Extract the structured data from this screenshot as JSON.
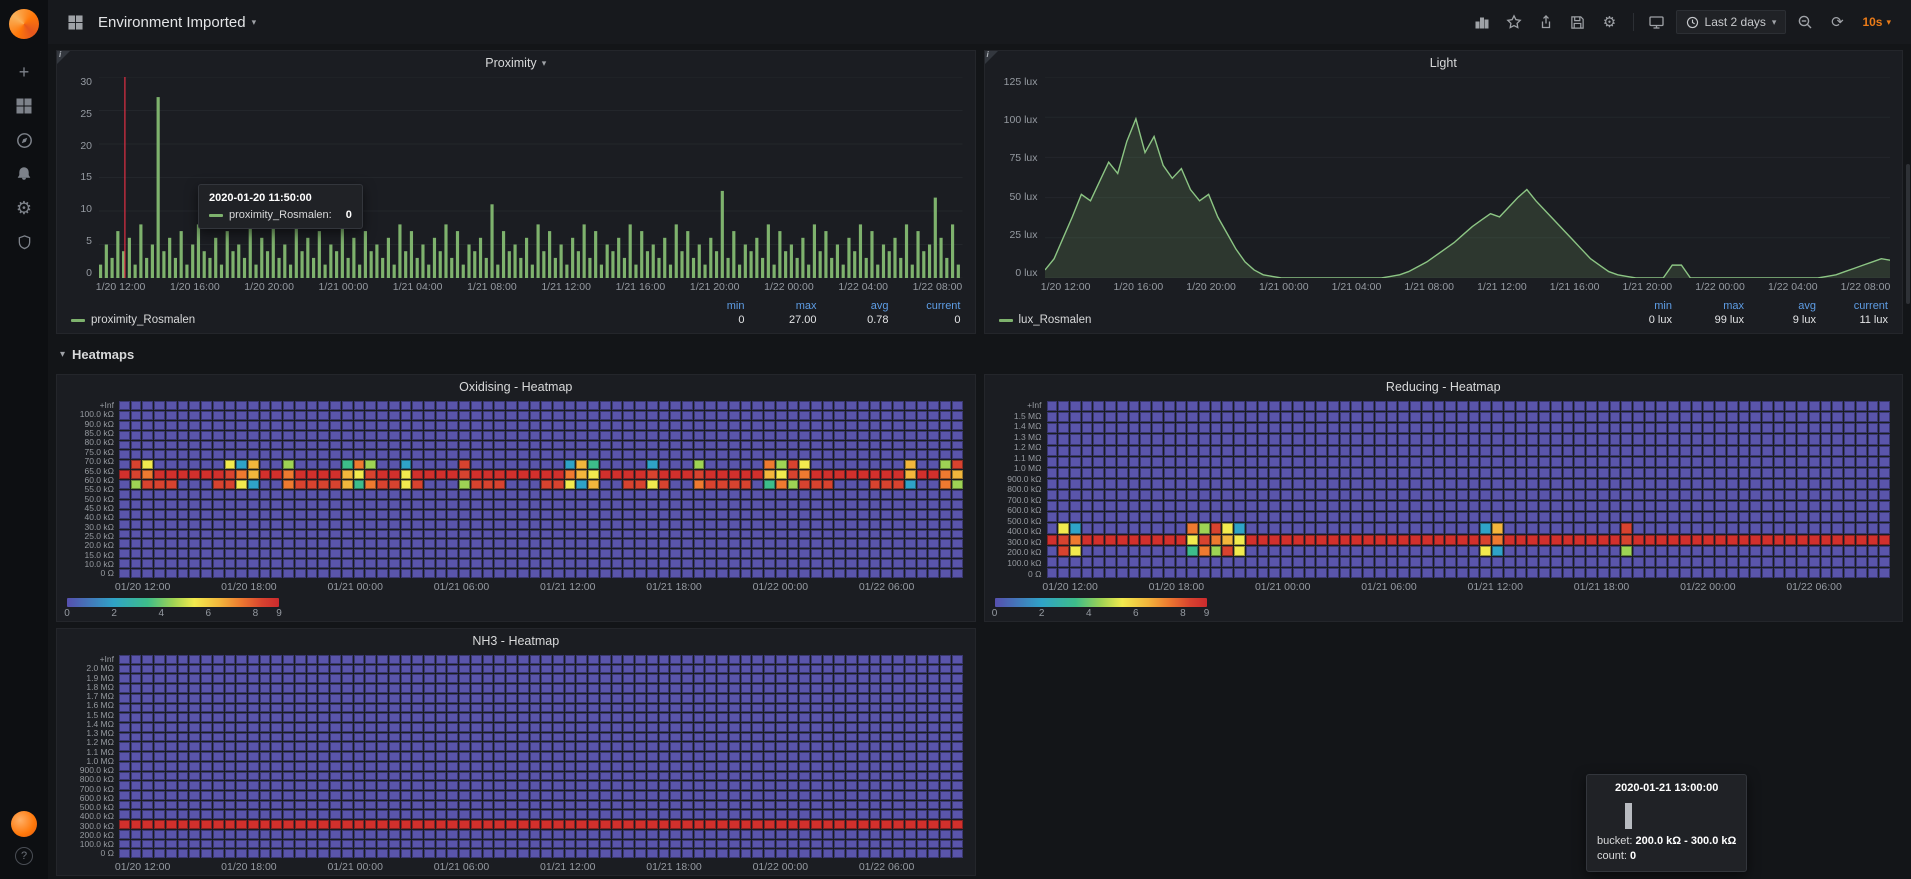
{
  "navbar": {
    "title": "Environment Imported",
    "time_range": "Last 2 days",
    "refresh_interval": "10s"
  },
  "row": {
    "heatmaps_label": "Heatmaps"
  },
  "panels": {
    "proximity": {
      "title": "Proximity",
      "series_label": "proximity_Rosmalen",
      "stats": {
        "headers": [
          "min",
          "max",
          "avg",
          "current"
        ],
        "values": [
          "0",
          "27.00",
          "0.78",
          "0"
        ]
      },
      "tooltip": {
        "time": "2020-01-20 11:50:00",
        "series": "proximity_Rosmalen:",
        "value": "0"
      }
    },
    "light": {
      "title": "Light",
      "series_label": "lux_Rosmalen",
      "stats": {
        "headers": [
          "min",
          "max",
          "avg",
          "current"
        ],
        "values": [
          "0 lux",
          "99 lux",
          "9 lux",
          "11 lux"
        ]
      }
    },
    "oxidising": {
      "title": "Oxidising - Heatmap"
    },
    "reducing": {
      "title": "Reducing - Heatmap"
    },
    "nh3": {
      "title": "NH3 - Heatmap"
    }
  },
  "heat_tooltip": {
    "time": "2020-01-21 13:00:00",
    "bucket_label": "bucket:",
    "bucket_value": "200.0 kΩ - 300.0 kΩ",
    "count_label": "count:",
    "count_value": "0"
  },
  "colors": {
    "green": "#7eb26d",
    "green_line": "#8cc584",
    "green_fill": "rgba(126,178,109,0.18)",
    "cursor_red": "#e02f44",
    "orange": "#eb7b18",
    "stat_header_blue": "#5e9de5",
    "heat_base": "#5a55ab"
  },
  "heat_palette": [
    "#564fae",
    "#3f6fc4",
    "#2fa3c7",
    "#3dbd8a",
    "#9ed354",
    "#f2ea4e",
    "#f2b63c",
    "#ee7a30",
    "#d8432f",
    "#d2302c"
  ],
  "chart_data": [
    {
      "id": "proximity",
      "type": "bar",
      "title": "Proximity",
      "series": "proximity_Rosmalen",
      "ylim": [
        0,
        30
      ],
      "yticks": [
        0,
        5,
        10,
        15,
        20,
        25,
        30
      ],
      "y_axis_labels": [
        "30",
        "25",
        "20",
        "15",
        "10",
        "5",
        "0"
      ],
      "x_labels": [
        "1/20 12:00",
        "1/20 16:00",
        "1/20 20:00",
        "1/21 00:00",
        "1/21 04:00",
        "1/21 08:00",
        "1/21 12:00",
        "1/21 16:00",
        "1/21 20:00",
        "1/22 00:00",
        "1/22 04:00",
        "1/22 08:00"
      ],
      "cursor_pct": 0.03,
      "values": [
        2,
        5,
        3,
        7,
        4,
        6,
        2,
        8,
        3,
        5,
        27,
        4,
        6,
        3,
        7,
        2,
        5,
        8,
        4,
        3,
        6,
        2,
        7,
        4,
        5,
        3,
        8,
        2,
        6,
        4,
        10,
        3,
        5,
        2,
        8,
        4,
        6,
        3,
        7,
        2,
        5,
        4,
        8,
        3,
        6,
        2,
        7,
        4,
        5,
        3,
        6,
        2,
        8,
        4,
        7,
        3,
        5,
        2,
        6,
        4,
        8,
        3,
        7,
        2,
        5,
        4,
        6,
        3,
        11,
        2,
        7,
        4,
        5,
        3,
        6,
        2,
        8,
        4,
        7,
        3,
        5,
        2,
        6,
        4,
        8,
        3,
        7,
        2,
        5,
        4,
        6,
        3,
        8,
        2,
        7,
        4,
        5,
        3,
        6,
        2,
        8,
        4,
        7,
        3,
        5,
        2,
        6,
        4,
        13,
        3,
        7,
        2,
        5,
        4,
        6,
        3,
        8,
        2,
        7,
        4,
        5,
        3,
        6,
        2,
        8,
        4,
        7,
        3,
        5,
        2,
        6,
        4,
        8,
        3,
        7,
        2,
        5,
        4,
        6,
        3,
        8,
        2,
        7,
        4,
        5,
        12,
        6,
        3,
        8,
        2
      ]
    },
    {
      "id": "light",
      "type": "area",
      "title": "Light",
      "series": "lux_Rosmalen",
      "ylim": [
        0,
        125
      ],
      "yticks": [
        0,
        25,
        50,
        75,
        100,
        125
      ],
      "y_axis_labels": [
        "125 lux",
        "100 lux",
        "75 lux",
        "50 lux",
        "25 lux",
        "0 lux"
      ],
      "x_labels": [
        "1/20 12:00",
        "1/20 16:00",
        "1/20 20:00",
        "1/21 00:00",
        "1/21 04:00",
        "1/21 08:00",
        "1/21 12:00",
        "1/21 16:00",
        "1/21 20:00",
        "1/22 00:00",
        "1/22 04:00",
        "1/22 08:00"
      ],
      "values": [
        5,
        12,
        25,
        38,
        52,
        48,
        60,
        72,
        65,
        85,
        99,
        78,
        88,
        70,
        62,
        68,
        55,
        48,
        52,
        38,
        28,
        18,
        10,
        5,
        2,
        1,
        0,
        0,
        0,
        0,
        0,
        0,
        0,
        0,
        0,
        0,
        0,
        0,
        1,
        2,
        4,
        7,
        10,
        14,
        18,
        22,
        27,
        32,
        36,
        40,
        38,
        44,
        50,
        55,
        48,
        42,
        36,
        30,
        24,
        18,
        12,
        8,
        4,
        2,
        1,
        0,
        0,
        0,
        0,
        8,
        8,
        0,
        0,
        0,
        0,
        0,
        0,
        0,
        0,
        0,
        0,
        0,
        0,
        0,
        0,
        0,
        1,
        2,
        4,
        6,
        8,
        10,
        12,
        11
      ]
    },
    {
      "id": "oxidising",
      "type": "heatmap",
      "title": "Oxidising - Heatmap",
      "y_labels": [
        "+Inf",
        "100.0 kΩ",
        "90.0 kΩ",
        "85.0 kΩ",
        "80.0 kΩ",
        "75.0 kΩ",
        "70.0 kΩ",
        "65.0 kΩ",
        "60.0 kΩ",
        "55.0 kΩ",
        "50.0 kΩ",
        "45.0 kΩ",
        "40.0 kΩ",
        "30.0 kΩ",
        "25.0 kΩ",
        "20.0 kΩ",
        "15.0 kΩ",
        "10.0 kΩ",
        "0 Ω"
      ],
      "x_labels": [
        "01/20 12:00",
        "01/20 18:00",
        "01/21 00:00",
        "01/21 06:00",
        "01/21 12:00",
        "01/21 18:00",
        "01/22 00:00",
        "01/22 06:00"
      ],
      "cols": 72,
      "hot_row": 7,
      "second_band": true,
      "clusters": [
        1,
        2,
        9,
        10,
        11,
        14,
        19,
        20,
        21,
        24,
        29,
        38,
        39,
        40,
        45,
        49,
        55,
        56,
        57,
        58,
        67,
        70,
        71
      ],
      "scale_ticks": [
        0,
        2,
        4,
        6,
        8,
        9
      ],
      "scale_max": 9
    },
    {
      "id": "reducing",
      "type": "heatmap",
      "title": "Reducing - Heatmap",
      "y_labels": [
        "+Inf",
        "1.5 MΩ",
        "1.4 MΩ",
        "1.3 MΩ",
        "1.2 MΩ",
        "1.1 MΩ",
        "1.0 MΩ",
        "900.0 kΩ",
        "800.0 kΩ",
        "700.0 kΩ",
        "600.0 kΩ",
        "500.0 kΩ",
        "400.0 kΩ",
        "300.0 kΩ",
        "200.0 kΩ",
        "100.0 kΩ",
        "0 Ω"
      ],
      "x_labels": [
        "01/20 12:00",
        "01/20 18:00",
        "01/21 00:00",
        "01/21 06:00",
        "01/21 12:00",
        "01/21 18:00",
        "01/22 00:00",
        "01/22 06:00"
      ],
      "cols": 72,
      "hot_row": 12,
      "second_band": false,
      "clusters": [
        1,
        2,
        12,
        13,
        14,
        15,
        16,
        37,
        38,
        49
      ],
      "scale_ticks": [
        0,
        2,
        4,
        6,
        8,
        9
      ],
      "scale_max": 9
    },
    {
      "id": "nh3",
      "type": "heatmap",
      "title": "NH3 - Heatmap",
      "y_labels": [
        "+Inf",
        "2.0 MΩ",
        "1.9 MΩ",
        "1.8 MΩ",
        "1.7 MΩ",
        "1.6 MΩ",
        "1.5 MΩ",
        "1.4 MΩ",
        "1.3 MΩ",
        "1.2 MΩ",
        "1.1 MΩ",
        "1.0 MΩ",
        "900.0 kΩ",
        "800.0 kΩ",
        "700.0 kΩ",
        "600.0 kΩ",
        "500.0 kΩ",
        "400.0 kΩ",
        "300.0 kΩ",
        "200.0 kΩ",
        "100.0 kΩ",
        "0 Ω"
      ],
      "x_labels": [
        "01/20 12:00",
        "01/20 18:00",
        "01/21 00:00",
        "01/21 06:00",
        "01/21 12:00",
        "01/21 18:00",
        "01/22 00:00",
        "01/22 06:00"
      ],
      "cols": 72,
      "hot_row": 17,
      "second_band": false,
      "clusters": [],
      "scale_ticks": [],
      "scale_max": 9
    }
  ]
}
